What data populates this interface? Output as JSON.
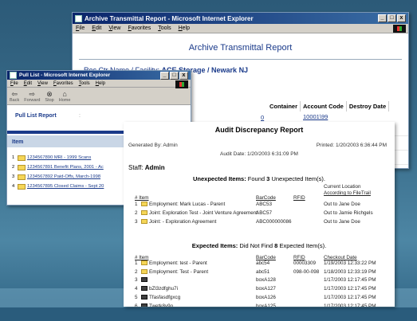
{
  "archive": {
    "title": "Archive Transmittal Report - Microsoft Internet Explorer",
    "menu": [
      "File",
      "Edit",
      "View",
      "Favorites",
      "Tools",
      "Help"
    ],
    "page_title": "Archive Transmittal Report",
    "facility_label": "Rec Ctr Name / Facility:",
    "facility_value": "ACE Storage / Newark NJ",
    "columns": [
      "Container",
      "Account Code",
      "Destroy Date"
    ],
    "account_code": "10001\\99",
    "row_fragment": "0"
  },
  "pull": {
    "title": "Pull List - Microsoft Internet Explorer",
    "menu": [
      "File",
      "Edit",
      "View",
      "Favorites",
      "Tools",
      "Help"
    ],
    "toolbar": [
      "Back",
      "Forward",
      "Stop",
      "Home"
    ],
    "report_title": "Pull List Report",
    "colon": ":",
    "item_header": "Item",
    "items": [
      {
        "num": "1",
        "text": "1234567890 MRI - 1999 Scans"
      },
      {
        "num": "2",
        "text": "1234567891 Benefit Plans, 2001 - Ac"
      },
      {
        "num": "3",
        "text": "1234567892 Paid-Offs, March-1998"
      },
      {
        "num": "4",
        "text": "1234567895 Closed Claims - Sept 20"
      }
    ]
  },
  "audit": {
    "title": "Audit Discrepancy Report",
    "generated_by": "Generated By: Admin",
    "printed": "Printed: 1/20/2003 6:36:44 PM",
    "audit_date": "Audit Date: 1/20/2003 6:31:09 PM",
    "staff_label": "Staff:",
    "staff_value": "Admin",
    "unexpected_label": "Unexpected Items:",
    "unexpected_text_pre": "Found",
    "unexpected_count": "3",
    "unexpected_text_post": "Unexpected Item(s).",
    "headers1": {
      "item": "# Item",
      "barcode": "BarCode",
      "rfid": "RFID",
      "location_line1": "Current Location",
      "location_line2": "According to FileTrail"
    },
    "unexpected": [
      {
        "num": "1",
        "item": "Employment: Mark Lucas - Parent",
        "barcode": "ABC53",
        "rfid": "",
        "location": "Out to Jane Doe"
      },
      {
        "num": "2",
        "item": "Joint: Exploration Test - Joint Venture Agreement",
        "barcode": "ABC57",
        "rfid": "",
        "location": "Out to Jamie Richgels"
      },
      {
        "num": "3",
        "item": "Joint: - Exploration Agreement",
        "barcode": "ABC000000086",
        "rfid": "",
        "location": "Out to Jane Doe"
      }
    ],
    "expected_label": "Expected Items:",
    "expected_text_pre": "Did Not Find",
    "expected_count": "8",
    "expected_text_post": "Expected Item(s).",
    "headers2": {
      "item": "# Item",
      "barcode": "BarCode",
      "rfid": "RFID",
      "checkout": "Checkout Date"
    },
    "expected": [
      {
        "num": "1",
        "icon": "folder",
        "item": "Employment: test - Parent",
        "barcode": "abc54",
        "rfid": "00003309",
        "date": "1/19/2003 12:33:22 PM"
      },
      {
        "num": "2",
        "icon": "folder",
        "item": "Employment: Test - Parent",
        "barcode": "abc51",
        "rfid": "098-00-098",
        "date": "1/18/2003 12:33:19 PM"
      },
      {
        "num": "3",
        "icon": "box",
        "item": "",
        "barcode": "boxA128",
        "rfid": "",
        "date": "1/17/2003 12:17:45 PM"
      },
      {
        "num": "4",
        "icon": "box",
        "item": "bZl3zdfghu7i",
        "barcode": "boxA127",
        "rfid": "",
        "date": "1/17/2003 12:17:45 PM"
      },
      {
        "num": "5",
        "icon": "box",
        "item": "Tfasfasdfgxcg",
        "barcode": "boxA126",
        "rfid": "",
        "date": "1/17/2003 12:17:45 PM"
      },
      {
        "num": "6",
        "icon": "box",
        "item": "Twetk8y9o",
        "barcode": "boxA125",
        "rfid": "",
        "date": "1/17/2003 12:17:45 PM"
      },
      {
        "num": "7",
        "icon": "box",
        "item": "Tfdsfsf",
        "barcode": "boxA124",
        "rfid": "",
        "date": "1/17/2003 12:17:45 PM"
      },
      {
        "num": "8",
        "icon": "box",
        "item": "Tabcdefghi",
        "barcode": "boxA123",
        "rfid": "",
        "date": "1/17/2003 12:17:44 PM"
      }
    ]
  },
  "window_buttons": {
    "minimize": "_",
    "maximize": "□",
    "close": "x"
  },
  "colors": {
    "background": "#2c5a78",
    "titlebar": "#0a246a",
    "link": "#1a3a8a",
    "folder": "#f5d657"
  }
}
